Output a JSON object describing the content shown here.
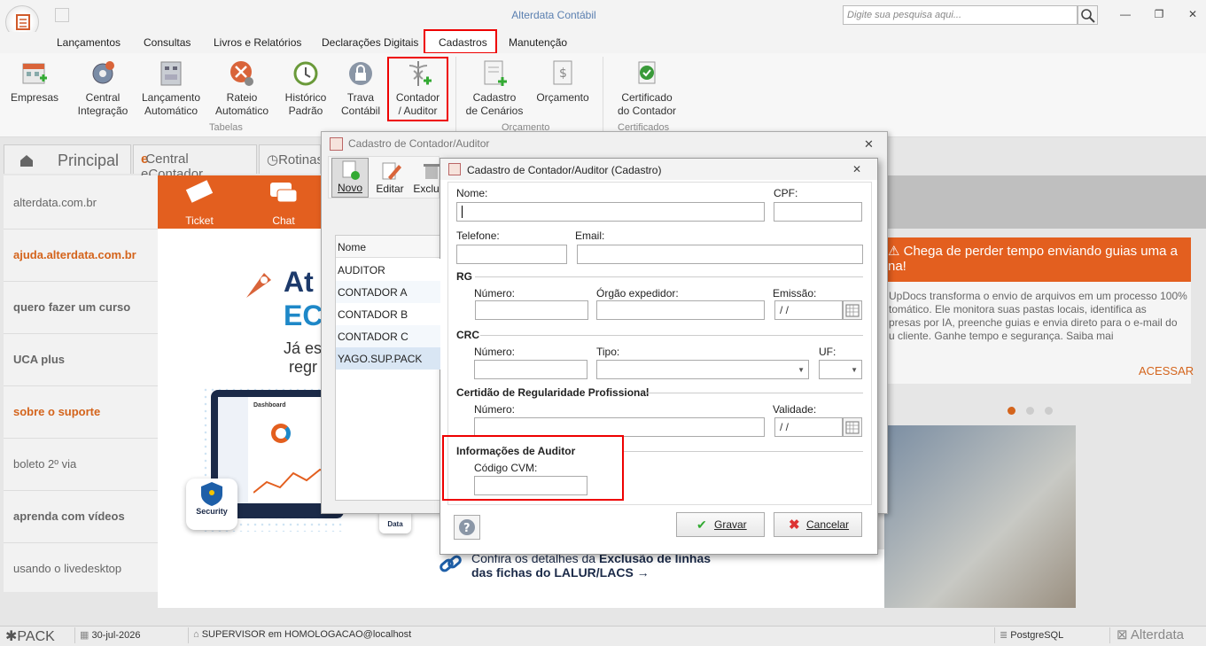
{
  "window": {
    "title": "Alterdata Contábil",
    "search_placeholder": "Digite sua pesquisa aqui..."
  },
  "menu": [
    "Lançamentos",
    "Consultas",
    "Livros e Relatórios",
    "Declarações Digitais",
    "Cadastros",
    "Manutenção"
  ],
  "ribbon": {
    "buttons": [
      {
        "l1": "Empresas",
        "l2": ""
      },
      {
        "l1": "Central",
        "l2": "Integração"
      },
      {
        "l1": "Lançamento",
        "l2": "Automático"
      },
      {
        "l1": "Rateio",
        "l2": "Automático"
      },
      {
        "l1": "Histórico",
        "l2": "Padrão"
      },
      {
        "l1": "Trava",
        "l2": "Contábil"
      },
      {
        "l1": "Contador",
        "l2": "/ Auditor"
      },
      {
        "l1": "Cadastro",
        "l2": "de Cenários"
      },
      {
        "l1": "Orçamento",
        "l2": ""
      },
      {
        "l1": "Certificado",
        "l2": "do Contador"
      }
    ],
    "groups": [
      "Tabelas",
      "Orçamento",
      "Certificados"
    ]
  },
  "tabs": [
    "Principal",
    "Central eContador",
    "Rotinas a"
  ],
  "leftnav": [
    {
      "label": "alterdata.com.br",
      "bold": false,
      "color": "#666"
    },
    {
      "label": "ajuda.alterdata.com.br",
      "bold": true,
      "color": "#d4641c"
    },
    {
      "label": "quero fazer um curso",
      "bold": true,
      "color": "#666"
    },
    {
      "label": "UCA plus",
      "bold": true,
      "color": "#666"
    },
    {
      "label": "sobre o suporte",
      "bold": true,
      "color": "#d4641c"
    },
    {
      "label": "boleto 2º via",
      "bold": false,
      "color": "#666"
    },
    {
      "label": "aprenda com vídeos",
      "bold": true,
      "color": "#666"
    },
    {
      "label": "usando o livedesktop",
      "bold": false,
      "color": "#666"
    }
  ],
  "banner": {
    "ticket": "Ticket",
    "chat": "Chat",
    "brand1": "At",
    "brand2": "EC",
    "tag1": "Já es",
    "tag2": "regr",
    "security": "Security",
    "data": "Data",
    "dash": "Dashboard"
  },
  "news": {
    "headline1": "Chega de perder tempo enviando guias uma a",
    "headline2": "na!",
    "body1": "UpDocs transforma o envio de arquivos em um processo 100%",
    "body2": "tomático. Ele monitora suas pastas locais, identifica as",
    "body3": "presas por IA, preenche guias e envia direto para o e-mail do",
    "body4": "u cliente. Ganhe tempo e segurança. Saiba mai",
    "action": "ACESSAR"
  },
  "bottom_link": {
    "line1a": "Confira os detalhes da ",
    "line1b": "Exclusão de linhas",
    "line2": "das fichas do LALUR/LACS →"
  },
  "dialog_outer": {
    "title": "Cadastro de Contador/Auditor",
    "tools": [
      "Novo",
      "Editar",
      "Exclu"
    ],
    "col_header": "Nome",
    "rows": [
      "AUDITOR",
      "CONTADOR A",
      "CONTADOR B",
      "CONTADOR C",
      "YAGO.SUP.PACK"
    ]
  },
  "dialog_inner": {
    "title": "Cadastro de Contador/Auditor (Cadastro)",
    "nome": "Nome:",
    "cpf": "CPF:",
    "telefone": "Telefone:",
    "email": "Email:",
    "rg": "RG",
    "rg_numero": "Número:",
    "rg_orgao": "Órgão expedidor:",
    "rg_emissao": "Emissão:",
    "date_mask": "/ /",
    "crc": "CRC",
    "crc_numero": "Número:",
    "crc_tipo": "Tipo:",
    "crc_uf": "UF:",
    "certidao": "Certidão de Regularidade Profissional",
    "cert_numero": "Número:",
    "cert_validade": "Validade:",
    "auditor": "Informações de Auditor",
    "cvm": "Código CVM:",
    "gravar": "Gravar",
    "cancelar": "Cancelar"
  },
  "status": {
    "pack": "PACK",
    "date": "30-jul-2026",
    "user": "SUPERVISOR em HOMOLOGACAO@localhost",
    "db": "PostgreSQL",
    "brand": "Alterdata"
  }
}
